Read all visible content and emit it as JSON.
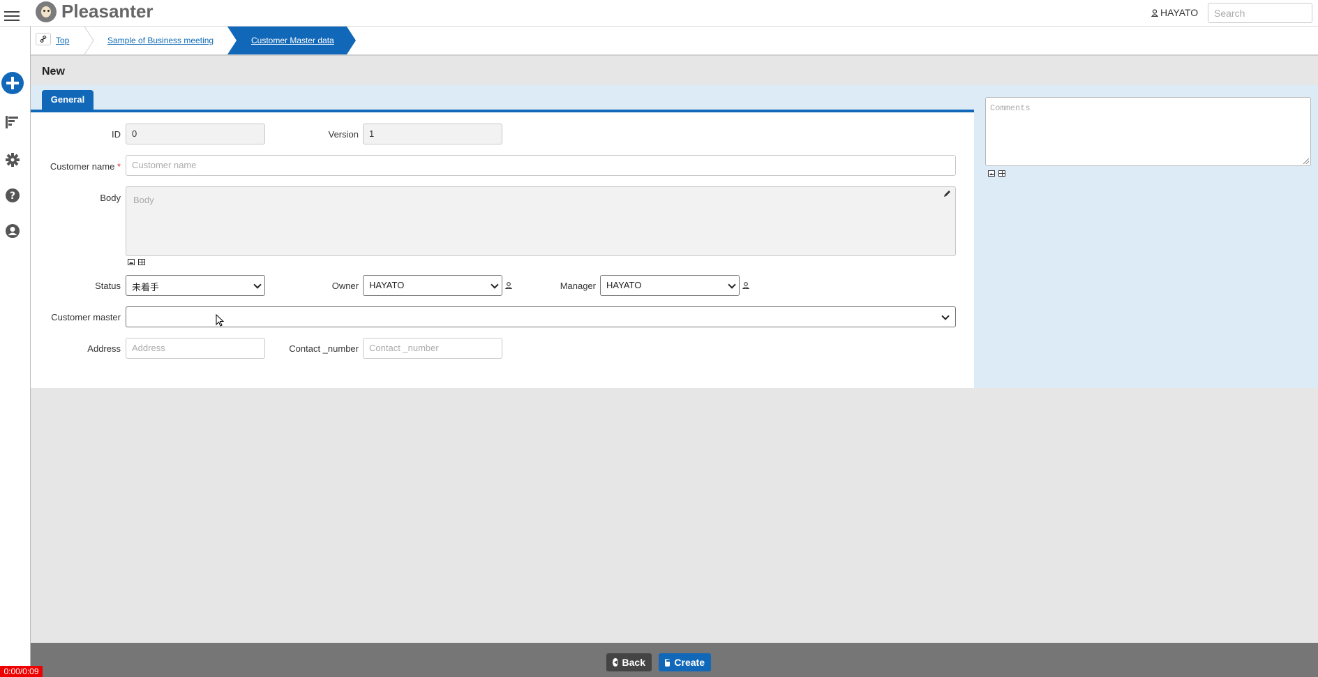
{
  "app": {
    "brand": "Pleasanter",
    "user": "HAYATO",
    "search_placeholder": "Search"
  },
  "breadcrumb": {
    "items": [
      {
        "label": "Top"
      },
      {
        "label": "Sample of Business meeting"
      },
      {
        "label": "Customer Master data",
        "active": true
      }
    ]
  },
  "sidebar": {
    "icons": [
      "hamburger-icon",
      "add-icon",
      "list-icon",
      "gear-icon",
      "help-icon",
      "user-icon"
    ],
    "accent": "#1168b9"
  },
  "page": {
    "title": "New",
    "tab": "General"
  },
  "form": {
    "id_label": "ID",
    "id_value": "0",
    "version_label": "Version",
    "version_value": "1",
    "customer_name_label": "Customer name",
    "customer_name_required": "*",
    "customer_name_placeholder": "Customer name",
    "body_label": "Body",
    "body_placeholder": "Body",
    "status_label": "Status",
    "status_value": "未着手",
    "owner_label": "Owner",
    "owner_value": "HAYATO",
    "manager_label": "Manager",
    "manager_value": "HAYATO",
    "customer_master_label": "Customer master",
    "customer_master_value": "",
    "address_label": "Address",
    "address_placeholder": "Address",
    "contact_label": "Contact _number",
    "contact_placeholder": "Contact _number"
  },
  "comments": {
    "placeholder": "Comments"
  },
  "footer": {
    "back_label": "Back",
    "create_label": "Create"
  },
  "recording": {
    "timer": "0:00/0:09"
  }
}
